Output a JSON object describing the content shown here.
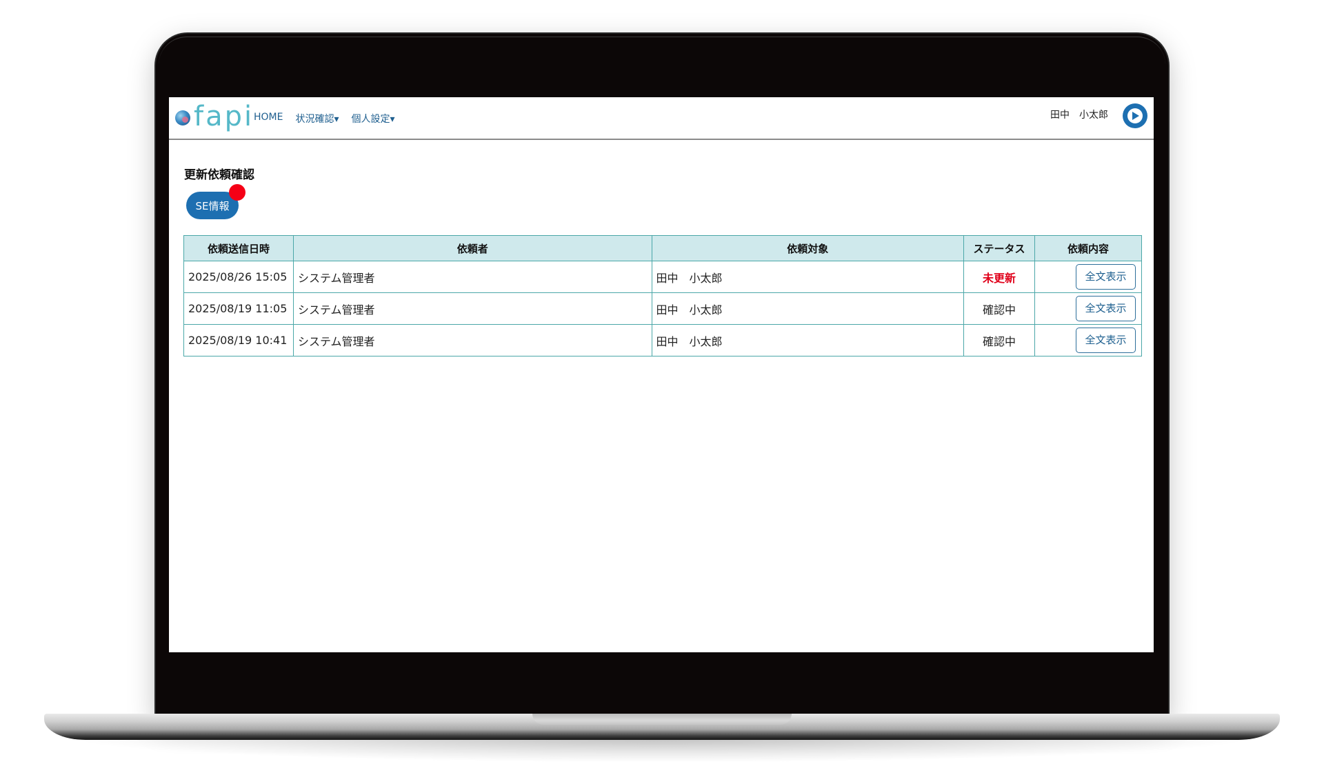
{
  "header": {
    "logo_text": "fapi",
    "nav": [
      "HOME",
      "状況確認▾",
      "個人設定▾"
    ],
    "user_name": "田中　小太郎"
  },
  "page": {
    "title": "更新依頼確認",
    "tab_label": "SE情報"
  },
  "table": {
    "columns": [
      "依頼送信日時",
      "依頼者",
      "依頼対象",
      "ステータス",
      "依頼内容"
    ],
    "rows": [
      {
        "date": "2025/08/26 15:05",
        "requester": "システム管理者",
        "target": "田中　小太郎",
        "status": "未更新",
        "action": "全文表示"
      },
      {
        "date": "2025/08/19 11:05",
        "requester": "システム管理者",
        "target": "田中　小太郎",
        "status": "確認中",
        "action": "全文表示"
      },
      {
        "date": "2025/08/19 10:41",
        "requester": "システム管理者",
        "target": "田中　小太郎",
        "status": "確認中",
        "action": "全文表示"
      }
    ]
  },
  "colors": {
    "accent": "#1d6fb1",
    "header_bg": "#cfe9ec",
    "table_border": "#4aa7a8",
    "status_alert": "#e0001a",
    "notification_dot": "#f50016"
  }
}
